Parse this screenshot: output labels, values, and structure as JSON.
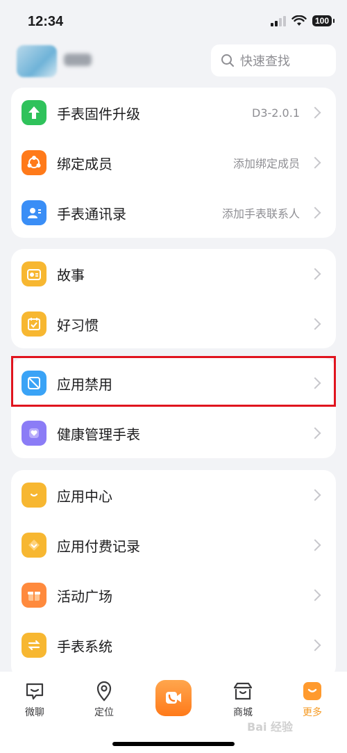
{
  "status_bar": {
    "time": "12:34",
    "battery": "100"
  },
  "header": {
    "search_placeholder": "快速查找"
  },
  "card1": {
    "items": [
      {
        "label": "手表固件升级",
        "value": "D3-2.0.1",
        "icon": "arrow-up-icon",
        "color": "#2fc25b"
      },
      {
        "label": "绑定成员",
        "value": "添加绑定成员",
        "icon": "members-icon",
        "color": "#ff7a1a"
      },
      {
        "label": "手表通讯录",
        "value": "添加手表联系人",
        "icon": "contact-card-icon",
        "color": "#3a8ef6"
      }
    ]
  },
  "card2": {
    "items": [
      {
        "label": "故事",
        "icon": "radio-icon",
        "color": "#f7b731"
      },
      {
        "label": "好习惯",
        "icon": "calendar-check-icon",
        "color": "#f7b731"
      }
    ]
  },
  "card3": {
    "items": [
      {
        "label": "应用禁用",
        "icon": "app-disable-icon",
        "color": "#3aa3f6"
      },
      {
        "label": "健康管理手表",
        "icon": "heart-watch-icon",
        "color": "#8b7cf6"
      }
    ]
  },
  "card4": {
    "items": [
      {
        "label": "应用中心",
        "icon": "shopping-bag-icon",
        "color": "#f7b731"
      },
      {
        "label": "应用付费记录",
        "icon": "payment-icon",
        "color": "#f7b731"
      },
      {
        "label": "活动广场",
        "icon": "gift-icon",
        "color": "#ff8a3d"
      },
      {
        "label": "手表系统",
        "icon": "swap-icon",
        "color": "#f7b731"
      }
    ]
  },
  "tabbar": {
    "tabs": [
      {
        "label": "微聊"
      },
      {
        "label": "定位"
      },
      {
        "label": "商城"
      },
      {
        "label": "更多"
      }
    ]
  },
  "watermark": "Bai 经验"
}
